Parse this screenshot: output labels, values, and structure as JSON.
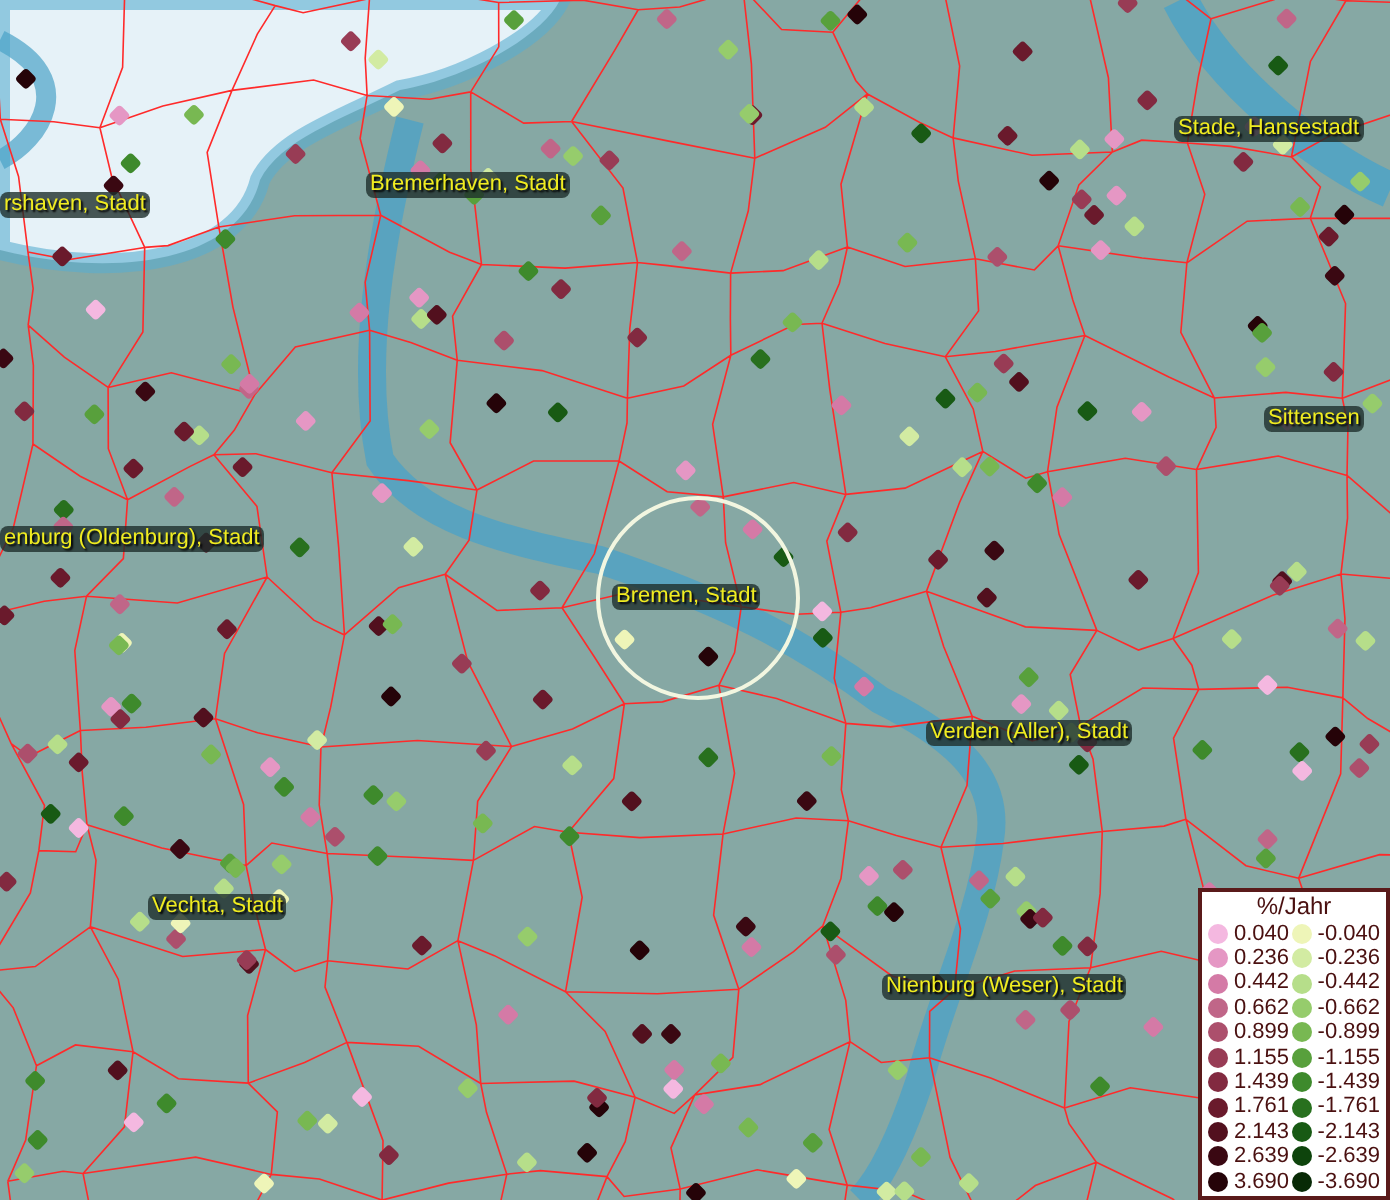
{
  "city_labels": [
    {
      "text": "rshaven, Stadt"
    },
    {
      "text": "Bremerhaven, Stadt"
    },
    {
      "text": "Stade, Hansestadt"
    },
    {
      "text": "Sittensen"
    },
    {
      "text": "enburg (Oldenburg), Stadt"
    },
    {
      "text": "Bremen, Stadt"
    },
    {
      "text": "Verden (Aller), Stadt"
    },
    {
      "text": "Vechta, Stadt"
    },
    {
      "text": "Nienburg (Weser), Stadt"
    }
  ],
  "legend": {
    "title": "%/Jahr",
    "rows": [
      {
        "positive": {
          "value": "0.040",
          "color": "#f4b8e0"
        },
        "negative": {
          "value": "-0.040",
          "color": "#eef5b8"
        }
      },
      {
        "positive": {
          "value": "0.236",
          "color": "#e597c4"
        },
        "negative": {
          "value": "-0.236",
          "color": "#d2eba2"
        }
      },
      {
        "positive": {
          "value": "0.442",
          "color": "#d47aa6"
        },
        "negative": {
          "value": "-0.442",
          "color": "#b6de8a"
        }
      },
      {
        "positive": {
          "value": "0.662",
          "color": "#c06688"
        },
        "negative": {
          "value": "-0.662",
          "color": "#96cc6c"
        }
      },
      {
        "positive": {
          "value": "0.899",
          "color": "#ac4f6c"
        },
        "negative": {
          "value": "-0.899",
          "color": "#78b852"
        }
      },
      {
        "positive": {
          "value": "1.155",
          "color": "#983c55"
        },
        "negative": {
          "value": "-1.155",
          "color": "#58a03c"
        }
      },
      {
        "positive": {
          "value": "1.439",
          "color": "#822a40"
        },
        "negative": {
          "value": "-1.439",
          "color": "#3e8a2c"
        }
      },
      {
        "positive": {
          "value": "1.761",
          "color": "#6a1a2c"
        },
        "negative": {
          "value": "-1.761",
          "color": "#28701e"
        }
      },
      {
        "positive": {
          "value": "2.143",
          "color": "#52101e"
        },
        "negative": {
          "value": "-2.143",
          "color": "#185a14"
        }
      },
      {
        "positive": {
          "value": "2.639",
          "color": "#3a0812"
        },
        "negative": {
          "value": "-2.639",
          "color": "#0e440c"
        }
      },
      {
        "positive": {
          "value": "3.690",
          "color": "#250308"
        },
        "negative": {
          "value": "-3.690",
          "color": "#082a06"
        }
      }
    ]
  }
}
